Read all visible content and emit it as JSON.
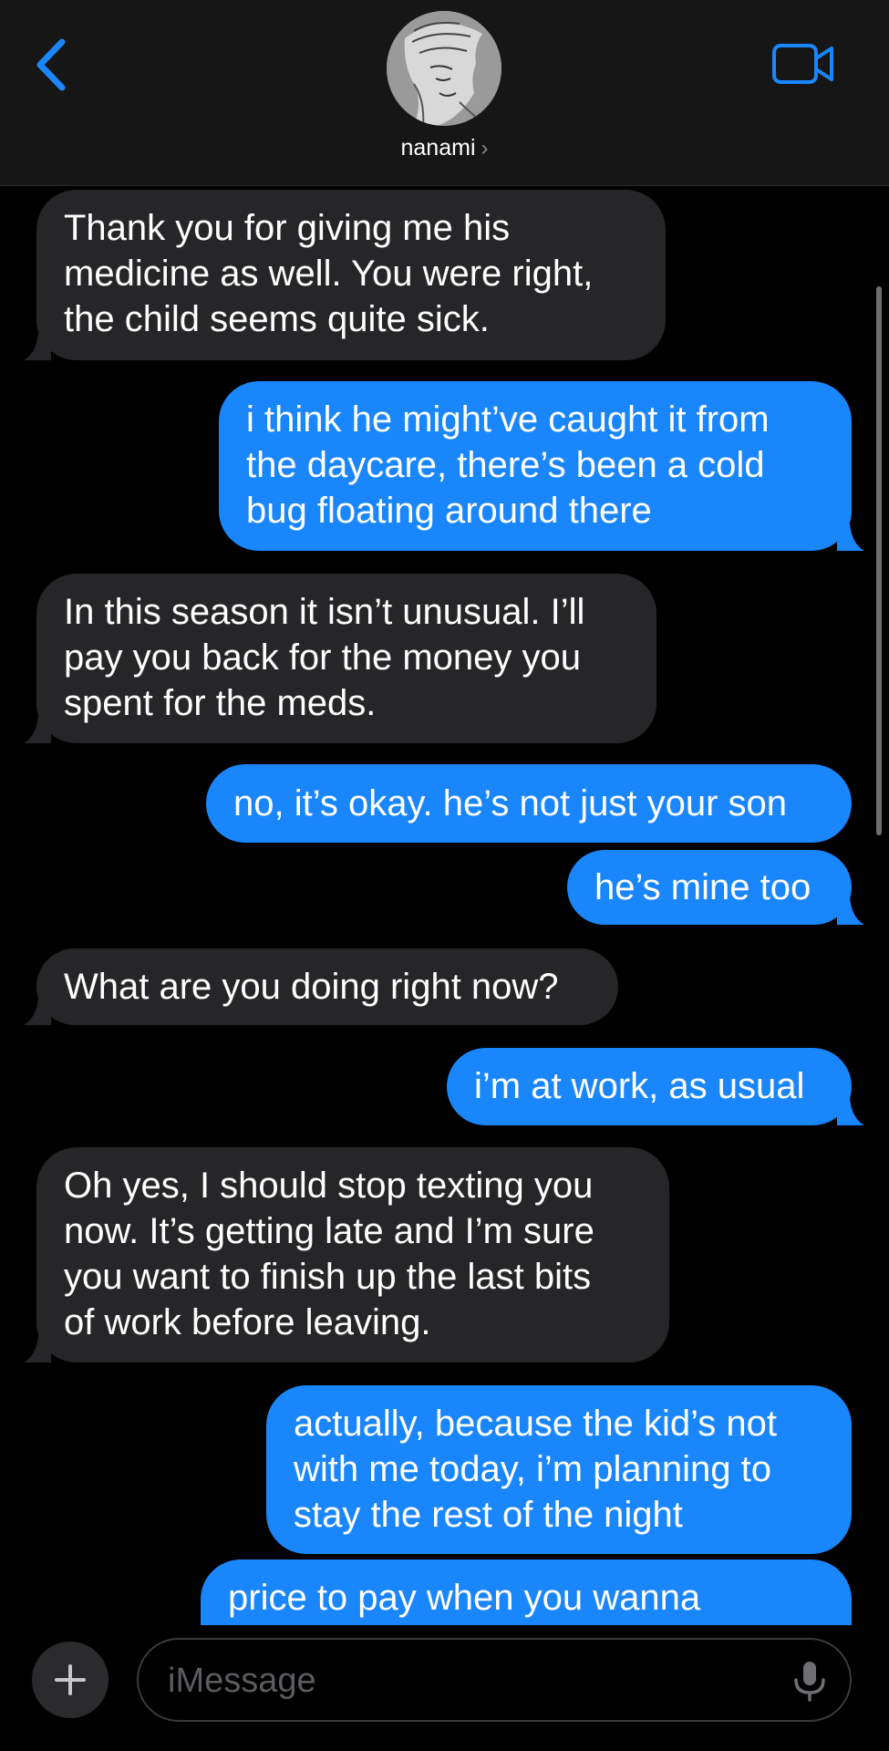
{
  "header": {
    "contact_name": "nanami",
    "chevron": "›"
  },
  "messages": [
    {
      "direction": "incoming",
      "lines": [
        "Thank you for giving me his",
        "medicine as well. You were right,",
        "the child seems quite sick."
      ]
    },
    {
      "direction": "outgoing",
      "lines": [
        "i think he might’ve caught it from",
        "the daycare, there’s been a cold",
        "bug floating around there"
      ]
    },
    {
      "direction": "incoming",
      "lines": [
        "In this season it isn’t unusual. I’ll",
        "pay you back for the money you",
        "spent for the meds."
      ]
    },
    {
      "direction": "outgoing",
      "lines": [
        "no, it’s okay. he’s not just your son"
      ]
    },
    {
      "direction": "outgoing",
      "lines": [
        "he’s mine too"
      ]
    },
    {
      "direction": "incoming",
      "lines": [
        "What are you doing right now?"
      ]
    },
    {
      "direction": "outgoing",
      "lines": [
        "i’m at work, as usual"
      ]
    },
    {
      "direction": "incoming",
      "lines": [
        "Oh yes, I should stop texting you",
        "now. It’s getting late and I’m sure",
        "you want to finish up the last bits",
        "of work before leaving."
      ]
    },
    {
      "direction": "outgoing",
      "lines": [
        "actually, because the kid’s not",
        "with me today, i’m planning to",
        "stay the rest of the night"
      ]
    },
    {
      "direction": "outgoing",
      "lines": [
        "price to pay when you wanna"
      ]
    }
  ],
  "composer": {
    "placeholder": "iMessage",
    "value": ""
  },
  "icons": {
    "back": "chevron-left-icon",
    "video": "video-camera-icon",
    "plus": "plus-icon",
    "mic": "microphone-icon"
  },
  "colors": {
    "accent": "#1a86fb",
    "incoming_bubble": "#262628",
    "outgoing_bubble": "#1a86fb",
    "background": "#000000",
    "header": "#161616"
  }
}
